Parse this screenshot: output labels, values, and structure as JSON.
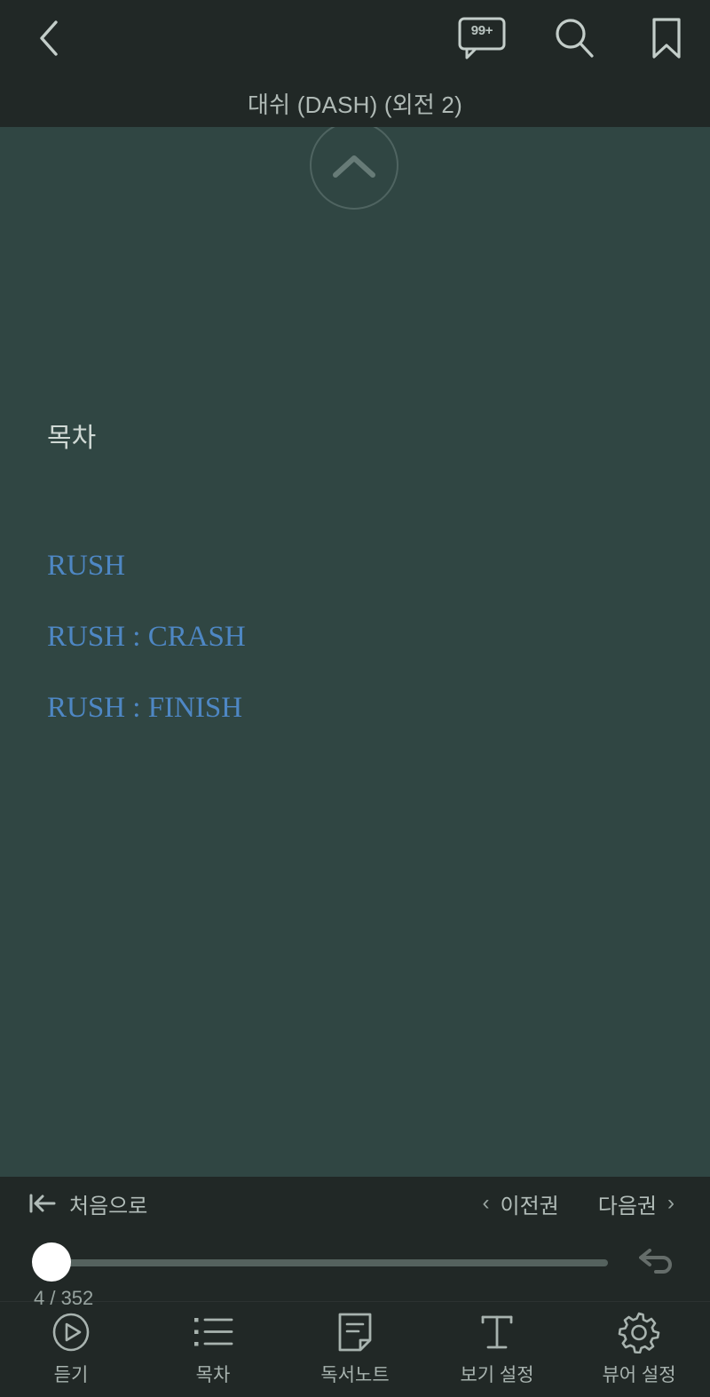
{
  "header": {
    "back_icon": "chevron-left-icon",
    "title": "대쉬 (DASH) (외전 2)",
    "comment_badge": "99+",
    "comment_icon": "comment-bubble-icon",
    "search_icon": "search-icon",
    "bookmark_icon": "bookmark-icon"
  },
  "scroll_up": {
    "icon": "chevron-up-icon"
  },
  "content": {
    "toc_heading": "목차",
    "links": [
      {
        "label": "RUSH"
      },
      {
        "label": "RUSH : CRASH"
      },
      {
        "label": "RUSH : FINISH"
      }
    ],
    "background_color": "#304643",
    "link_color": "#4e87c4"
  },
  "bottom": {
    "to_start_label": "처음으로",
    "to_start_icon": "skip-to-start-icon",
    "prev_volume_label": "이전권",
    "prev_volume_icon": "chevron-left-icon",
    "next_volume_label": "다음권",
    "next_volume_icon": "chevron-right-icon",
    "undo_icon": "undo-arrow-icon",
    "page_indicator": "4 / 352",
    "slider": {
      "current_page": 4,
      "total_pages": 352,
      "percent": 1
    }
  },
  "toolbar": {
    "items": [
      {
        "label": "듣기",
        "icon": "play-circle-icon"
      },
      {
        "label": "목차",
        "icon": "list-icon"
      },
      {
        "label": "독서노트",
        "icon": "note-page-icon"
      },
      {
        "label": "보기 설정",
        "icon": "text-format-icon"
      },
      {
        "label": "뷰어 설정",
        "icon": "gear-icon"
      }
    ]
  }
}
